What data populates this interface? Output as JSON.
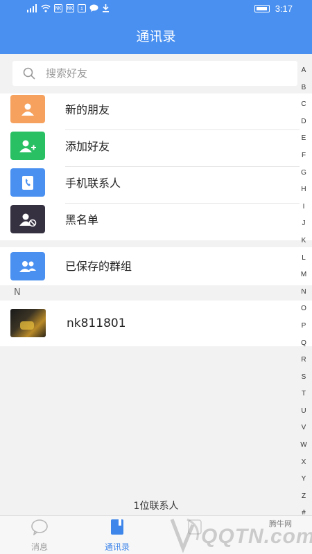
{
  "status_bar": {
    "time": "3:17",
    "icons": [
      "signal-icon",
      "wifi-icon",
      "nk-icon",
      "nk-icon",
      "info-icon",
      "chat-icon",
      "download-icon"
    ]
  },
  "header": {
    "title": "通讯录"
  },
  "search": {
    "placeholder": "搜索好友"
  },
  "quick_actions": [
    {
      "label": "新的朋友",
      "color": "#f6a25e",
      "icon": "person-icon"
    },
    {
      "label": "添加好友",
      "color": "#29c063",
      "icon": "add-person-icon"
    },
    {
      "label": "手机联系人",
      "color": "#4a90f0",
      "icon": "phone-book-icon"
    },
    {
      "label": "黑名单",
      "color": "#363141",
      "icon": "blocked-user-icon"
    }
  ],
  "groups": {
    "label": "已保存的群组",
    "color": "#4a90f0",
    "icon": "group-icon"
  },
  "contact_section": {
    "letter": "N",
    "contacts": [
      {
        "name": "nk811801"
      }
    ]
  },
  "footer": {
    "count_text": "1位联系人"
  },
  "index_letters": [
    "A",
    "B",
    "C",
    "D",
    "E",
    "F",
    "G",
    "H",
    "I",
    "J",
    "K",
    "L",
    "M",
    "N",
    "O",
    "P",
    "Q",
    "R",
    "S",
    "T",
    "U",
    "V",
    "W",
    "X",
    "Y",
    "Z",
    "#"
  ],
  "tabs": [
    {
      "label": "消息",
      "active": false
    },
    {
      "label": "通讯录",
      "active": true
    }
  ],
  "watermark": {
    "text": "QQTN.com",
    "small": "腾牛网"
  },
  "colors": {
    "primary": "#4a90f0",
    "tab_active": "#3f86ea",
    "tab_inactive": "#9a9a9a"
  }
}
